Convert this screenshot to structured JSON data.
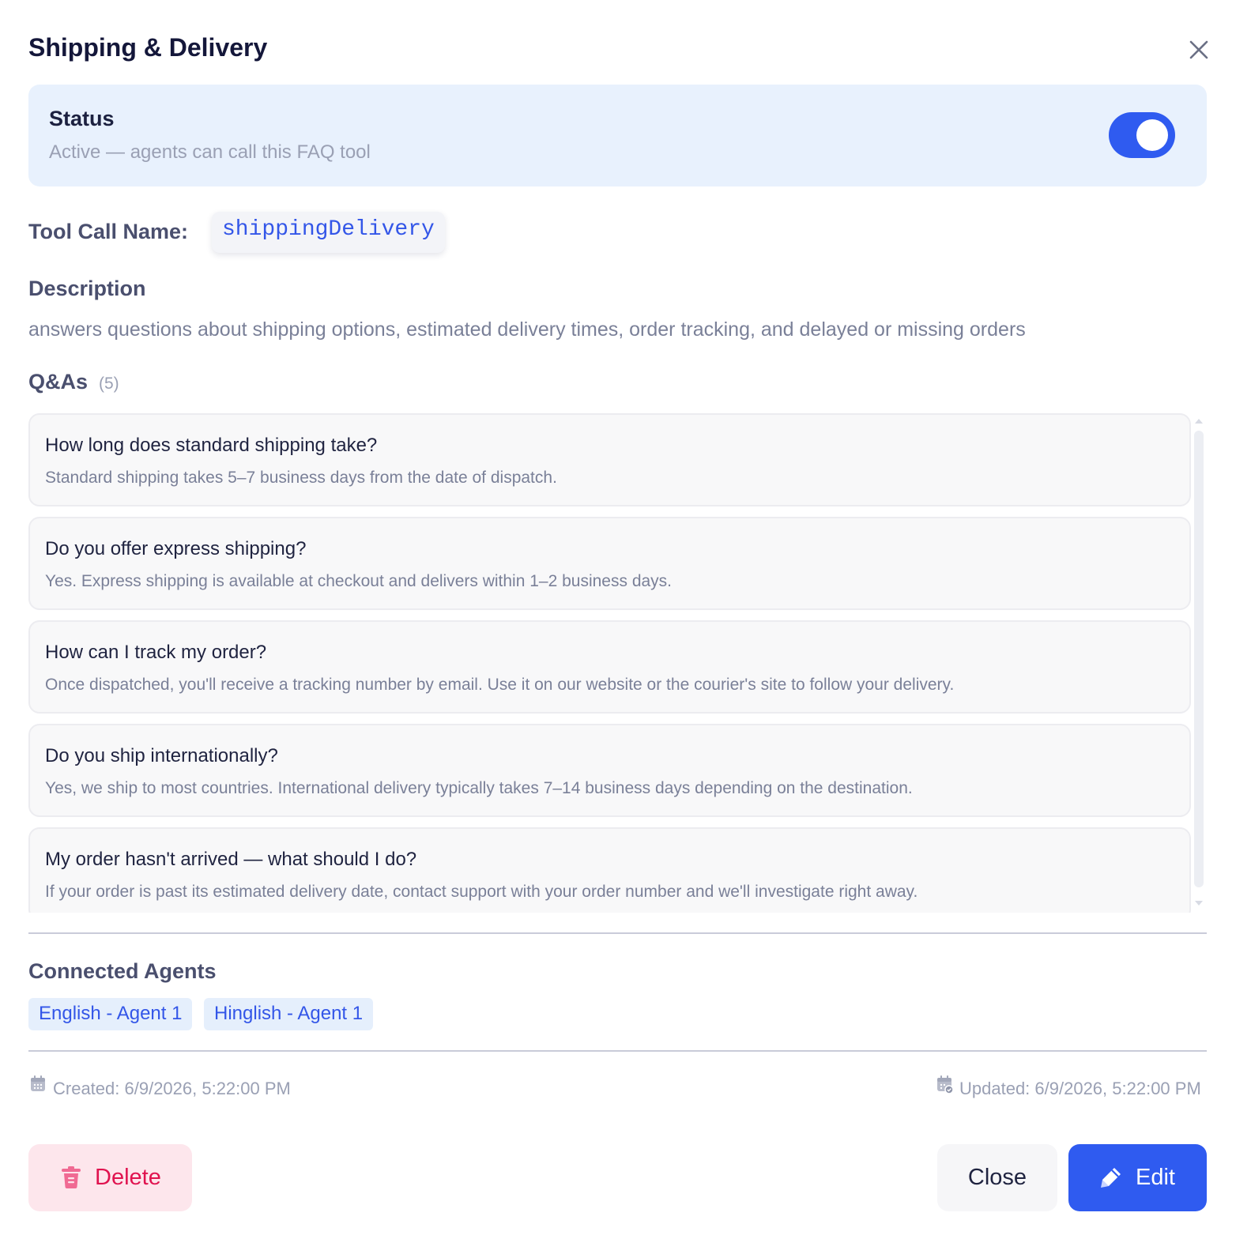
{
  "dialog": {
    "title": "Shipping & Delivery"
  },
  "status": {
    "title": "Status",
    "subtitle": "Active — agents can call this FAQ tool",
    "enabled": true,
    "accent_color": "#2f5bf0"
  },
  "tool_call": {
    "label": "Tool Call Name:",
    "name": "shippingDelivery"
  },
  "description": {
    "label": "Description",
    "text": "answers questions about shipping options, estimated delivery times, order tracking, and delayed or missing orders"
  },
  "qas": {
    "label": "Q&As",
    "count": "(5)",
    "items": [
      {
        "question": "How long does standard shipping take?",
        "answer": "Standard shipping takes 5–7 business days from the date of dispatch."
      },
      {
        "question": "Do you offer express shipping?",
        "answer": "Yes. Express shipping is available at checkout and delivers within 1–2 business days."
      },
      {
        "question": "How can I track my order?",
        "answer": "Once dispatched, you'll receive a tracking number by email. Use it on our website or the courier's site to follow your delivery."
      },
      {
        "question": "Do you ship internationally?",
        "answer": "Yes, we ship to most countries. International delivery typically takes 7–14 business days depending on the destination."
      },
      {
        "question": "My order hasn't arrived — what should I do?",
        "answer": "If your order is past its estimated delivery date, contact support with your order number and we'll investigate right away."
      }
    ]
  },
  "connected_agents": {
    "label": "Connected Agents",
    "agents": [
      "English - Agent 1",
      "Hinglish - Agent 1"
    ]
  },
  "meta": {
    "created": "Created: 6/9/2026, 5:22:00 PM",
    "updated": "Updated: 6/9/2026, 5:22:00 PM",
    "created_icon": "calendar-icon",
    "updated_icon": "calendar-check-icon"
  },
  "actions": {
    "delete_label": "Delete",
    "close_label": "Close",
    "edit_label": "Edit",
    "delete_icon": "trash-icon",
    "edit_icon": "pencil-icon",
    "danger_color": "#e0134f",
    "primary_color": "#2f5bf0"
  }
}
